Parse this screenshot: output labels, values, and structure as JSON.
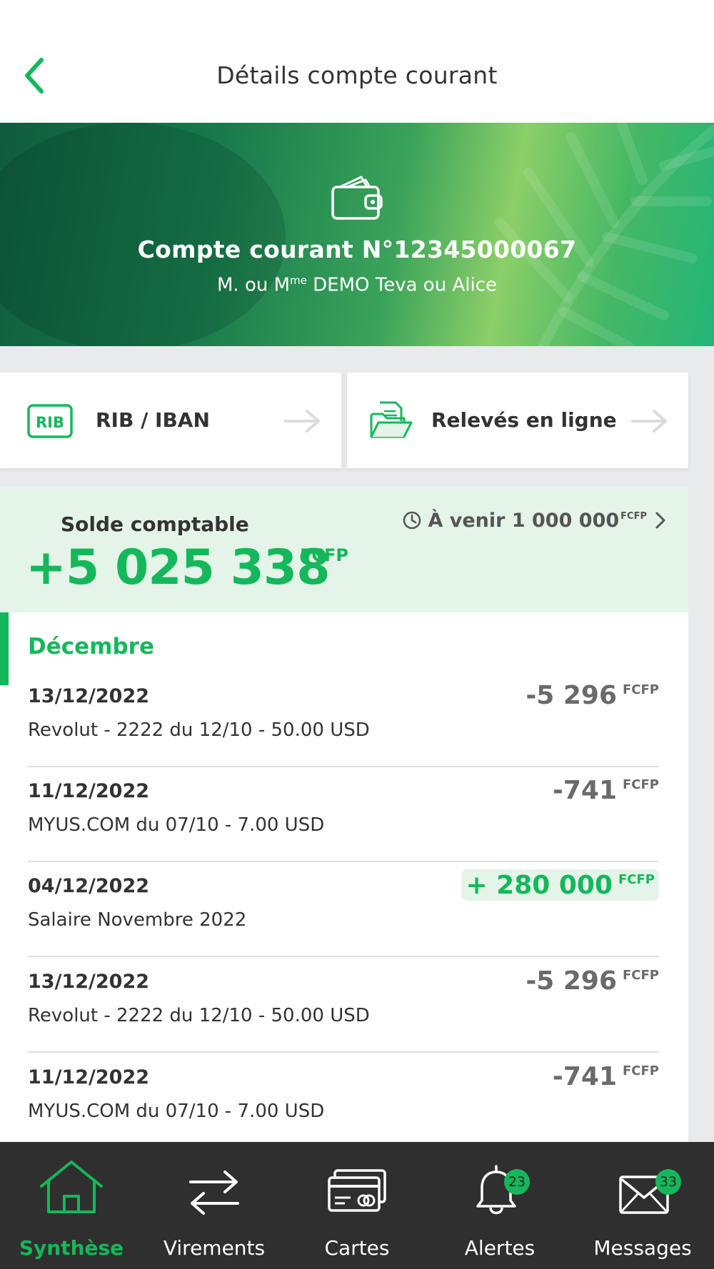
{
  "header": {
    "title": "Détails compte courant",
    "back_icon": "chevron-left-icon"
  },
  "account": {
    "title": "Compte courant N°12345000067",
    "holder_prefix": "M. ou M",
    "holder_sup": "me",
    "holder_suffix": " DEMO Teva ou Alice",
    "icon": "wallet-icon"
  },
  "actions": [
    {
      "label": "RIB / IBAN",
      "icon_text": "RIB",
      "icon": "rib-icon"
    },
    {
      "label": "Relevés en ligne",
      "icon": "folder-documents-icon"
    }
  ],
  "balance": {
    "label": "Solde comptable",
    "amount": "+5 025 338",
    "currency": "FCFP",
    "upcoming_text": "À venir 1 000 000",
    "upcoming_currency": "FCFP"
  },
  "transactions": {
    "month": "Décembre",
    "items": [
      {
        "date": "13/12/2022",
        "description": "Revolut - 2222 du 12/10 - 50.00 USD",
        "amount": "-5 296",
        "currency": "FCFP",
        "type": "debit"
      },
      {
        "date": "11/12/2022",
        "description": "MYUS.COM du 07/10 - 7.00 USD",
        "amount": "-741",
        "currency": "FCFP",
        "type": "debit"
      },
      {
        "date": "04/12/2022",
        "description": "Salaire Novembre 2022",
        "amount": "+ 280 000",
        "currency": "FCFP",
        "type": "credit"
      },
      {
        "date": "13/12/2022",
        "description": "Revolut - 2222 du 12/10 - 50.00 USD",
        "amount": "-5 296",
        "currency": "FCFP",
        "type": "debit"
      },
      {
        "date": "11/12/2022",
        "description": "MYUS.COM du 07/10 - 7.00 USD",
        "amount": "-741",
        "currency": "FCFP",
        "type": "debit"
      }
    ]
  },
  "nav": {
    "items": [
      {
        "label": "Synthèse",
        "icon": "home-icon",
        "active": true
      },
      {
        "label": "Virements",
        "icon": "transfer-arrows-icon"
      },
      {
        "label": "Cartes",
        "icon": "cards-icon"
      },
      {
        "label": "Alertes",
        "icon": "bell-icon",
        "badge": "23"
      },
      {
        "label": "Messages",
        "icon": "envelope-icon",
        "badge": "33"
      }
    ]
  },
  "colors": {
    "accent": "#14b85a",
    "nav_background": "#2f2f2f",
    "balance_background": "#e4f4e8"
  }
}
